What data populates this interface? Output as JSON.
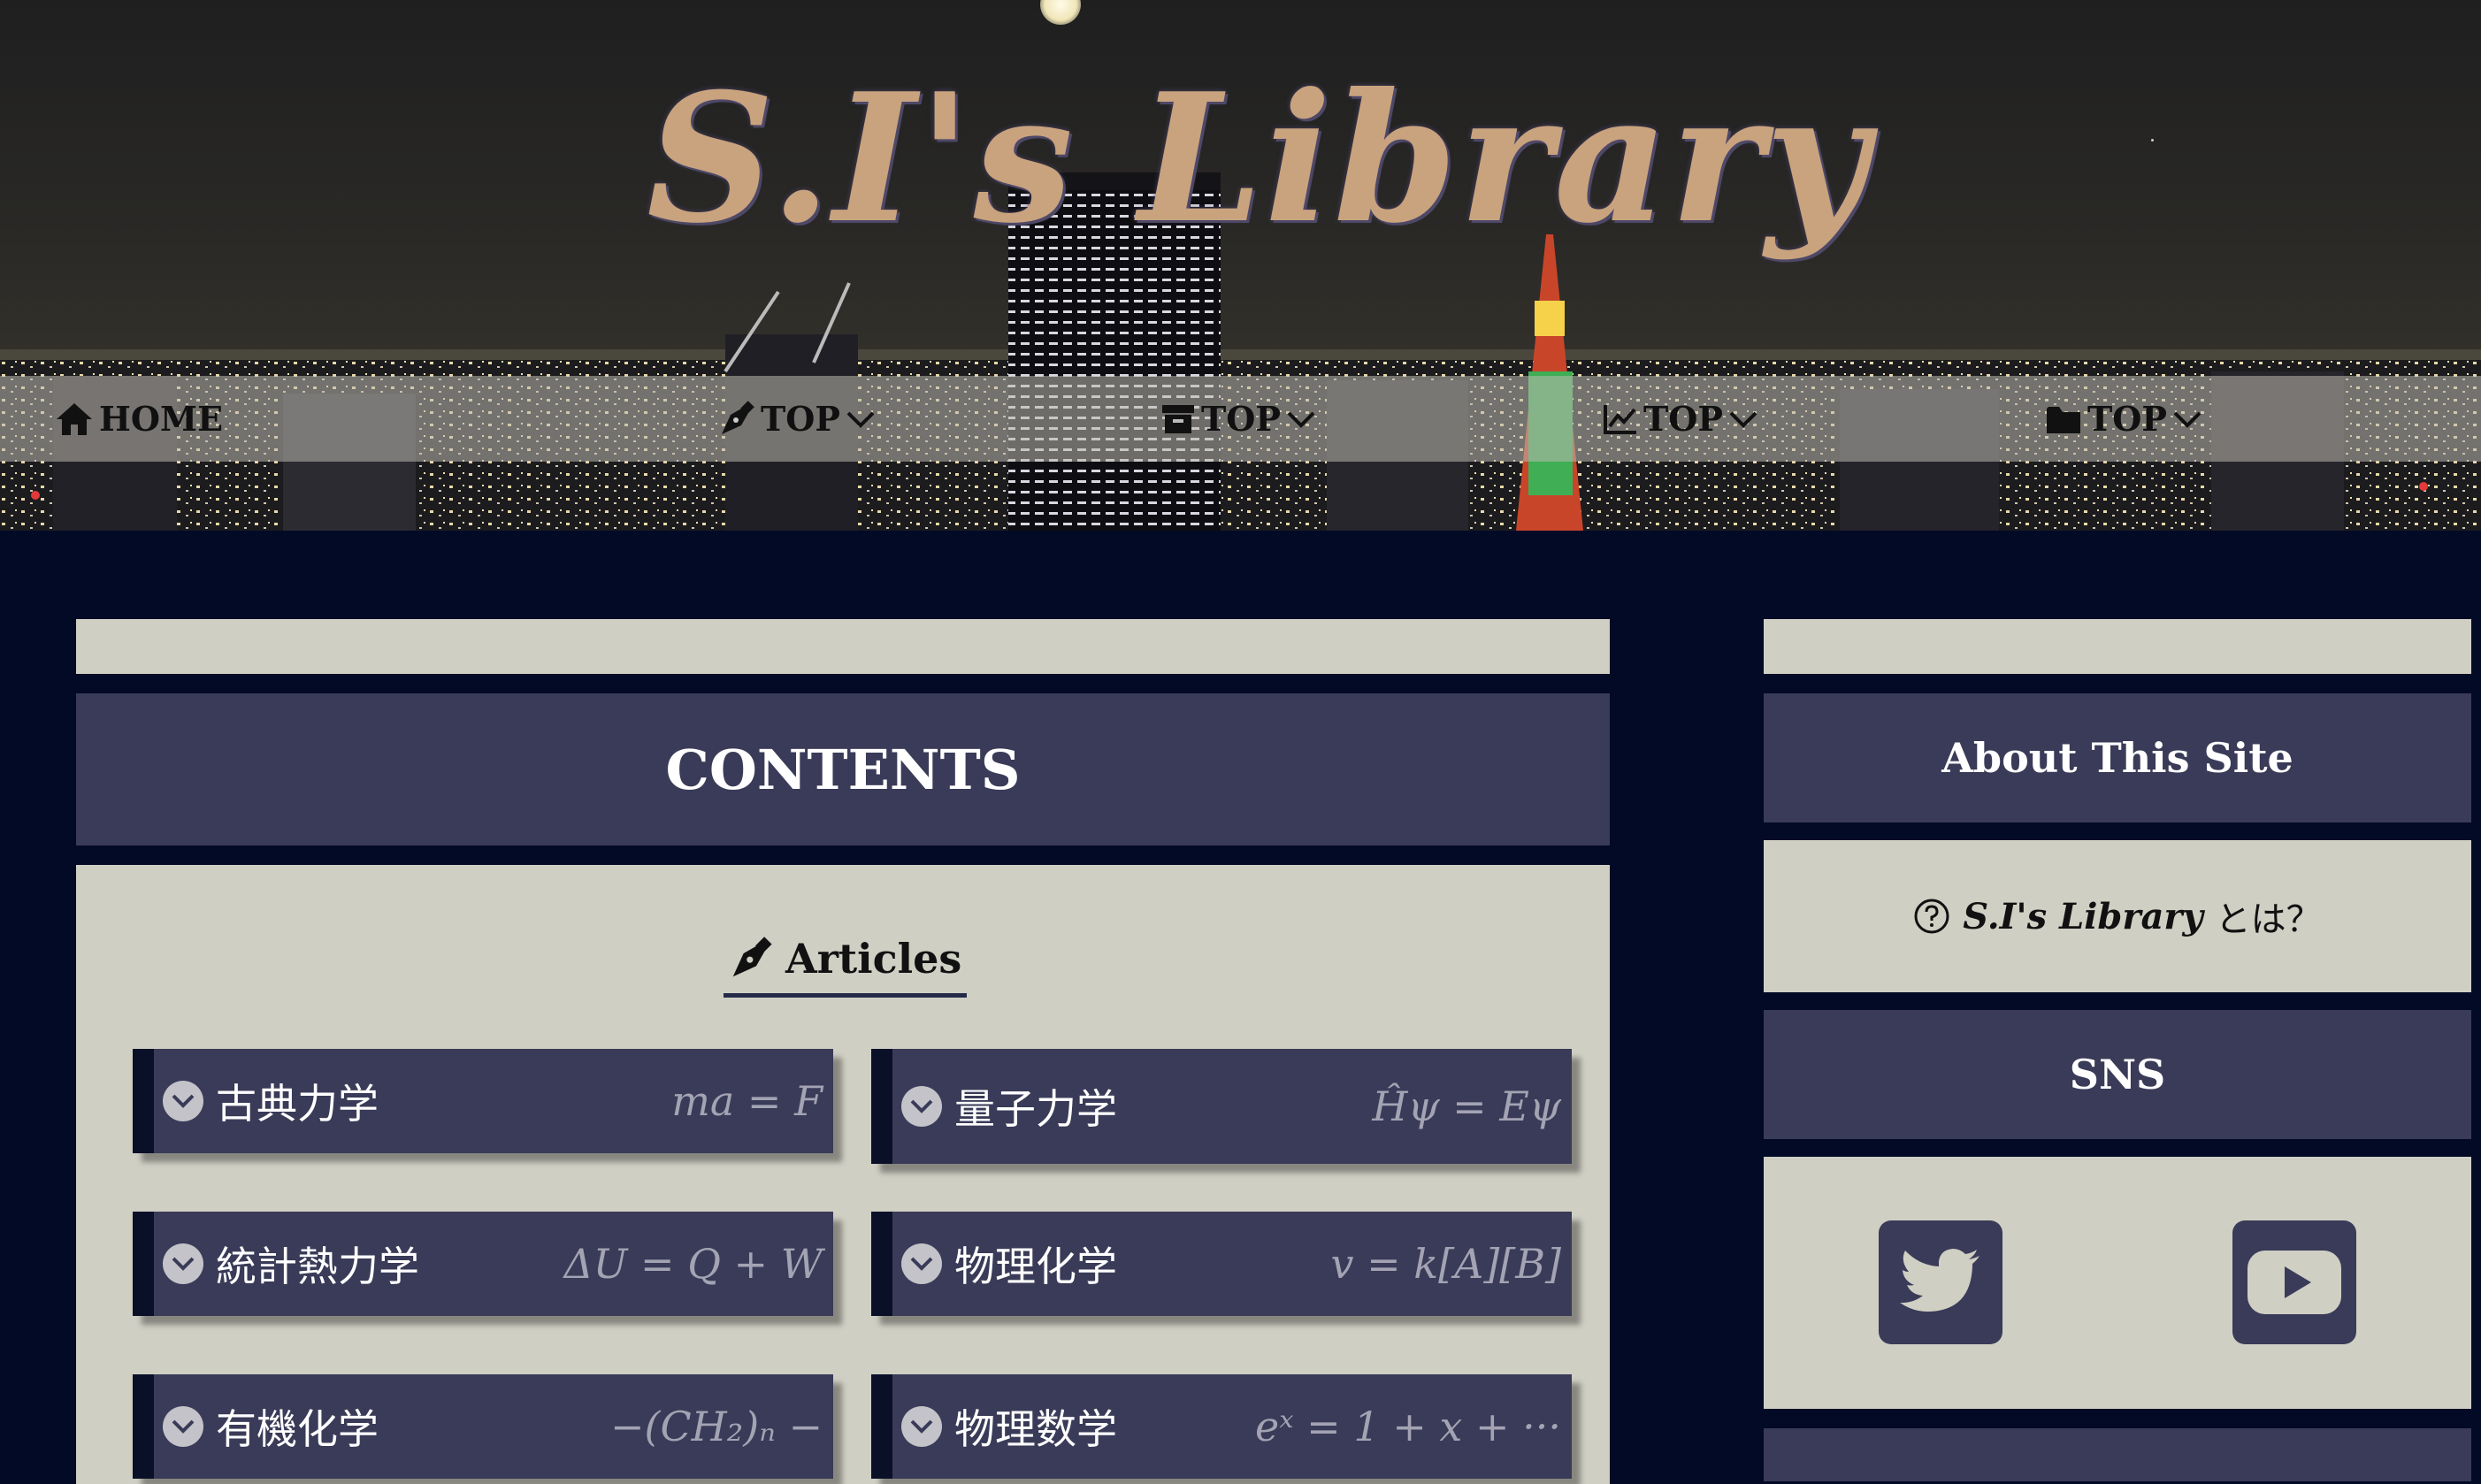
{
  "site": {
    "title": "S.I's Library"
  },
  "nav": {
    "items": [
      {
        "label": "HOME",
        "icon": "home-icon"
      },
      {
        "label": "TOP",
        "icon": "pen-nib-icon",
        "dropdown": true
      },
      {
        "label": "TOP",
        "icon": "archive-box-icon",
        "dropdown": true
      },
      {
        "label": "TOP",
        "icon": "line-chart-icon",
        "dropdown": true
      },
      {
        "label": "TOP",
        "icon": "folder-icon",
        "dropdown": true
      }
    ]
  },
  "main": {
    "contents_title": "CONTENTS",
    "articles_heading": "Articles",
    "articles": [
      {
        "label": "古典力学",
        "formula": "ma = F"
      },
      {
        "label": "量子力学",
        "formula": "Ĥψ = Eψ"
      },
      {
        "label": "統計熱力学",
        "formula": "ΔU = Q + W"
      },
      {
        "label": "物理化学",
        "formula": "v = k[A][B]"
      },
      {
        "label": "有機化学",
        "formula": "−(CH₂)ₙ −"
      },
      {
        "label": "物理数学",
        "formula": "eˣ = 1 + x + ···"
      }
    ]
  },
  "sidebar": {
    "about_title": "About This Site",
    "about_link": {
      "brand": "S.I's Library",
      "suffix": "とは？"
    },
    "sns_title": "SNS",
    "sns": [
      {
        "icon": "twitter-icon"
      },
      {
        "icon": "youtube-icon"
      }
    ]
  },
  "colors": {
    "page_bg": "#020a26",
    "panel_bg": "#cfcfc4",
    "bar_bg": "#3a3b58",
    "title_gold": "#c9a37e"
  }
}
